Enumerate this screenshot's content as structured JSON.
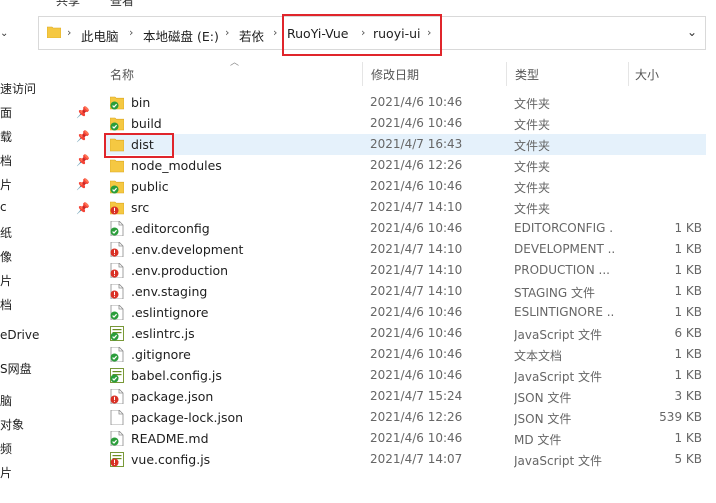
{
  "ribbon": [
    "共享",
    "查看"
  ],
  "address": {
    "crumbs": [
      "此电脑",
      "本地磁盘 (E:)",
      "若依",
      "RuoYi-Vue",
      "ruoyi-ui"
    ]
  },
  "nav": {
    "items": [
      "速访问",
      "面",
      "载",
      "档",
      "片",
      "c",
      "纸",
      "像",
      "片",
      "档",
      "eDrive",
      "S网盘",
      "脑",
      "对象",
      "频",
      "片"
    ]
  },
  "columns": {
    "name": "名称",
    "date": "修改日期",
    "type": "类型",
    "size": "大小"
  },
  "files": [
    {
      "name": "bin",
      "date": "2021/4/6 10:46",
      "type": "文件夹",
      "size": "",
      "icon": "folder-synced-icon"
    },
    {
      "name": "build",
      "date": "2021/4/6 10:46",
      "type": "文件夹",
      "size": "",
      "icon": "folder-synced-icon"
    },
    {
      "name": "dist",
      "date": "2021/4/7 16:43",
      "type": "文件夹",
      "size": "",
      "icon": "folder-icon"
    },
    {
      "name": "node_modules",
      "date": "2021/4/6 12:26",
      "type": "文件夹",
      "size": "",
      "icon": "folder-icon"
    },
    {
      "name": "public",
      "date": "2021/4/6 10:46",
      "type": "文件夹",
      "size": "",
      "icon": "folder-synced-icon"
    },
    {
      "name": "src",
      "date": "2021/4/7 14:10",
      "type": "文件夹",
      "size": "",
      "icon": "folder-modified-icon"
    },
    {
      "name": ".editorconfig",
      "date": "2021/4/6 10:46",
      "type": "EDITORCONFIG ...",
      "size": "1 KB",
      "icon": "file-synced-icon"
    },
    {
      "name": ".env.development",
      "date": "2021/4/7 14:10",
      "type": "DEVELOPMENT ...",
      "size": "1 KB",
      "icon": "file-modified-icon"
    },
    {
      "name": ".env.production",
      "date": "2021/4/7 14:10",
      "type": "PRODUCTION ...",
      "size": "1 KB",
      "icon": "file-modified-icon"
    },
    {
      "name": ".env.staging",
      "date": "2021/4/7 14:10",
      "type": "STAGING 文件",
      "size": "1 KB",
      "icon": "file-modified-icon"
    },
    {
      "name": ".eslintignore",
      "date": "2021/4/6 10:46",
      "type": "ESLINTIGNORE ...",
      "size": "1 KB",
      "icon": "file-synced-icon"
    },
    {
      "name": ".eslintrc.js",
      "date": "2021/4/6 10:46",
      "type": "JavaScript 文件",
      "size": "6 KB",
      "icon": "js-file-synced-icon"
    },
    {
      "name": ".gitignore",
      "date": "2021/4/6 10:46",
      "type": "文本文档",
      "size": "1 KB",
      "icon": "file-synced-icon"
    },
    {
      "name": "babel.config.js",
      "date": "2021/4/6 10:46",
      "type": "JavaScript 文件",
      "size": "1 KB",
      "icon": "js-file-synced-icon"
    },
    {
      "name": "package.json",
      "date": "2021/4/7 15:24",
      "type": "JSON 文件",
      "size": "3 KB",
      "icon": "file-modified-icon"
    },
    {
      "name": "package-lock.json",
      "date": "2021/4/6 12:26",
      "type": "JSON 文件",
      "size": "539 KB",
      "icon": "file-icon"
    },
    {
      "name": "README.md",
      "date": "2021/4/6 10:46",
      "type": "MD 文件",
      "size": "1 KB",
      "icon": "file-synced-icon"
    },
    {
      "name": "vue.config.js",
      "date": "2021/4/7 14:07",
      "type": "JavaScript 文件",
      "size": "5 KB",
      "icon": "js-file-modified-icon"
    }
  ],
  "colors": {
    "highlight": "#e0252b",
    "folder": "#f5c842",
    "synced": "#2a9d3a",
    "modified": "#d93025",
    "selected_row": "#e5f1fb"
  }
}
